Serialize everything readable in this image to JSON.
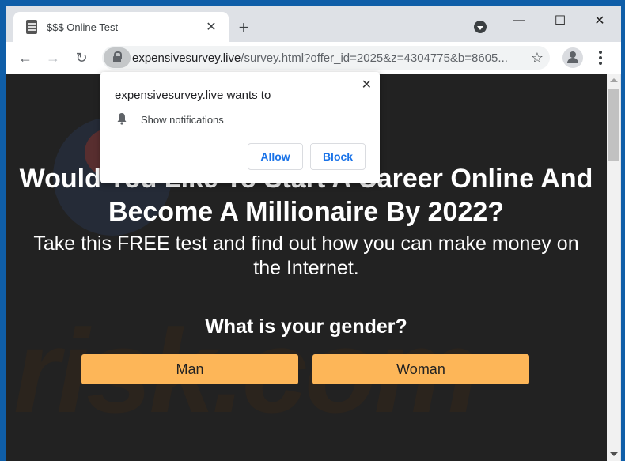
{
  "browser": {
    "tab": {
      "title": "$$$ Online Test",
      "favicon": "document-icon",
      "close_glyph": "✕"
    },
    "new_tab_glyph": "+",
    "window_controls": {
      "minimize": "—",
      "maximize": "☐",
      "close": "✕"
    },
    "nav": {
      "back": "←",
      "forward": "→",
      "reload": "↻"
    },
    "omnibox": {
      "domain": "expensivesurvey.live",
      "path": "/survey.html?offer_id=2025&z=4304775&b=8605...",
      "bookmark_glyph": "☆"
    }
  },
  "permission_prompt": {
    "title": "expensivesurvey.live wants to",
    "permission": "Show notifications",
    "allow_label": "Allow",
    "block_label": "Block",
    "close_glyph": "✕"
  },
  "page": {
    "headline": "Would You Like To Start A Career Online And Become A Millionaire By 2022?",
    "subheadline": "Take this FREE test and find out how you can make money on the Internet.",
    "question": "What is your gender?",
    "answers": [
      "Man",
      "Woman"
    ],
    "watermark": "risk.com",
    "colors": {
      "background": "#222222",
      "button": "#fdb658",
      "text": "#ffffff"
    }
  }
}
